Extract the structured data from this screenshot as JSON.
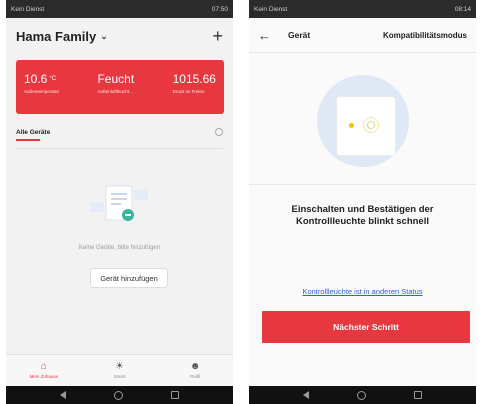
{
  "left": {
    "status": {
      "left": "Kein Dienst",
      "right": "07:50"
    },
    "header": {
      "title": "Hama Family",
      "chevron_icon": "chevron-down-icon",
      "add_icon": "plus-icon"
    },
    "weather": {
      "temp": {
        "value": "10.6",
        "unit": "°C",
        "label": "Außentemperatur"
      },
      "humidity": {
        "value": "Feucht",
        "label": "Außenluftfeucht..."
      },
      "pressure": {
        "value": "1015.66",
        "label": "Druck im Freien"
      },
      "color": "#e8383f"
    },
    "tabs": {
      "all_devices": "Alle Geräte",
      "settings_icon": "gear-icon"
    },
    "empty": {
      "message": "Keine Geräte, bitte hinzufügen",
      "add_button": "Gerät hinzufügen"
    },
    "tabbar": [
      {
        "label": "Mein Zuhause",
        "icon": "home-icon",
        "glyph": "⌂",
        "active": true
      },
      {
        "label": "Smart",
        "icon": "sun-icon",
        "glyph": "☀",
        "active": false
      },
      {
        "label": "Profil",
        "icon": "profile-icon",
        "glyph": "☻",
        "active": false
      }
    ]
  },
  "right": {
    "status": {
      "left": "Kein Dienst",
      "right": "08:14"
    },
    "header": {
      "back_icon": "back-arrow-icon",
      "title": "Gerät",
      "mode": "Kompatibilitätsmodus"
    },
    "instruction": "Einschalten und Bestätigen der Kontrollleuchte blinkt schnell",
    "link": "Kontrollleuchte ist in anderen Status",
    "next_button": "Nächster Schritt",
    "accent": "#e8383f",
    "link_color": "#2f67c9"
  }
}
